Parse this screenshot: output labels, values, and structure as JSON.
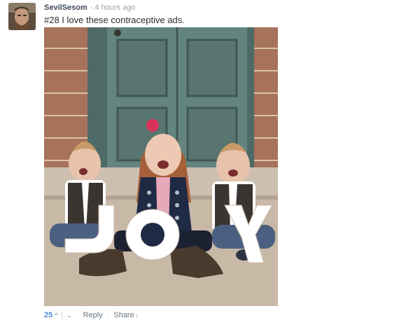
{
  "comment": {
    "author": "SevilSesom",
    "separator": "·",
    "timestamp": "4 hours ago",
    "text": "#28 I love these contraceptive ads.",
    "image_caption_letters": [
      "J",
      "O",
      "Y"
    ],
    "votes": {
      "count": "25",
      "up_icon": "^",
      "divider": "|",
      "down_icon": "⌄"
    },
    "actions": {
      "bullet": "·",
      "reply": "Reply",
      "share": "Share",
      "share_chevron": "›"
    }
  },
  "colors": {
    "author": "#3d4a5a",
    "meta": "#9aa3ad",
    "vote_accent": "#4a8ad0",
    "action_text": "#6b7780"
  }
}
